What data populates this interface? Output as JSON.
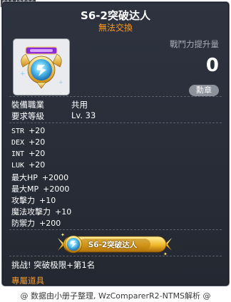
{
  "item_id": "01143536",
  "tooltip": {
    "title": "S6-2突破达人",
    "subtitle": "無法交換",
    "power_label": "戰鬥力提升量",
    "power_value": "0",
    "medal_button": "勳章"
  },
  "requirements": {
    "job_label": "裝備職業",
    "job_value": "共用",
    "level_label": "要求等級",
    "level_value": "Lv. 33"
  },
  "stats": [
    {
      "label": "STR",
      "value": "+20"
    },
    {
      "label": "DEX",
      "value": "+20"
    },
    {
      "label": "INT",
      "value": "+20"
    },
    {
      "label": "LUK",
      "value": "+20"
    },
    {
      "label": "最大HP",
      "value": "+2000"
    },
    {
      "label": "最大MP",
      "value": "+2000"
    },
    {
      "label": "攻擊力",
      "value": "+10"
    },
    {
      "label": "魔法攻擊力",
      "value": "+10"
    },
    {
      "label": "防禦力",
      "value": "+200"
    }
  ],
  "medal_banner_text": "S6-2突破达人",
  "description": "挑战! 突破极限+第1名",
  "exclusive_label": "專屬道具",
  "footer": "@ 数据由小册子整理, WzComparerR2-NTMS解析 @",
  "colors": {
    "tooltip_bg": "#2a2e38",
    "accent_orange": "#ff9a1f",
    "label_gray": "#a9adb5"
  },
  "icons": {
    "item": "medal-icon",
    "banner": "medal-banner-icon"
  }
}
